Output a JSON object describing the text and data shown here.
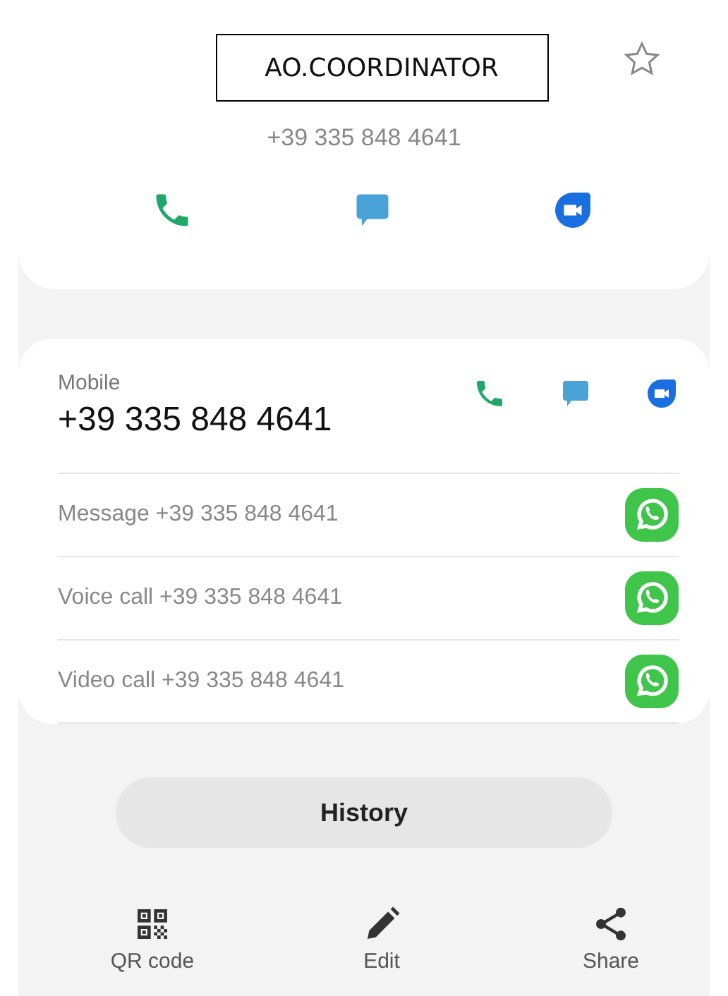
{
  "contact": {
    "name": "AO.COORDINATOR",
    "favorite": false,
    "number": "+39 335 848 4641"
  },
  "quick_actions": [
    {
      "kind": "call"
    },
    {
      "kind": "message"
    },
    {
      "kind": "video"
    }
  ],
  "numbers": [
    {
      "label": "Mobile",
      "value": "+39 335 848 4641",
      "actions": [
        {
          "kind": "call"
        },
        {
          "kind": "message"
        },
        {
          "kind": "video"
        }
      ]
    }
  ],
  "app_actions": [
    {
      "text": "Message +39 335 848 4641",
      "kind": "whatsapp"
    },
    {
      "text": "Voice call +39 335 848 4641",
      "kind": "whatsapp"
    },
    {
      "text": "Video call +39 335 848 4641",
      "kind": "whatsapp"
    }
  ],
  "history_button": "History",
  "bottom_bar": [
    {
      "label": "QR code",
      "kind": "qr"
    },
    {
      "label": "Edit",
      "kind": "edit"
    },
    {
      "label": "Share",
      "kind": "share"
    }
  ]
}
